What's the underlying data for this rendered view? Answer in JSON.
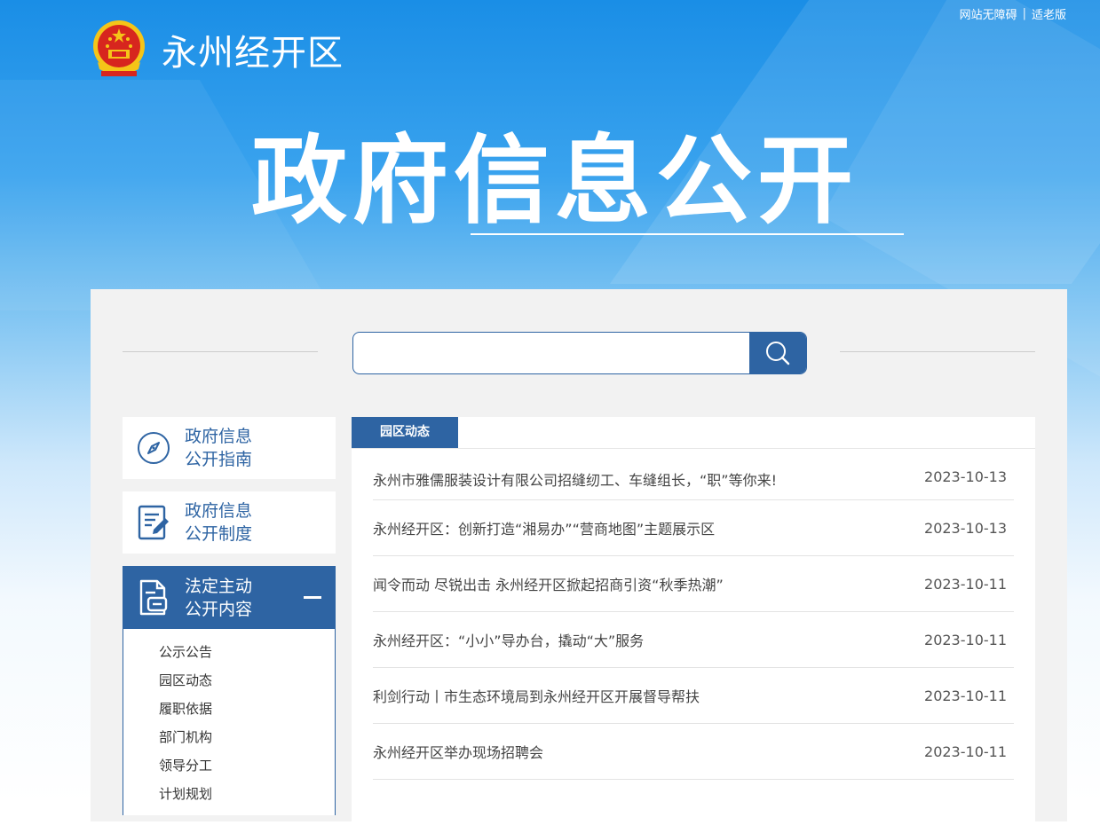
{
  "header": {
    "site_name": "永州经开区",
    "links": [
      "网站无障碍",
      "适老版"
    ],
    "separator": "|",
    "banner_title": "政府信息公开"
  },
  "search": {
    "placeholder": "",
    "button_icon": "search-icon"
  },
  "sidebar": {
    "cards": [
      {
        "line1": "政府信息",
        "line2": "公开指南",
        "icon": "compass-icon"
      },
      {
        "line1": "政府信息",
        "line2": "公开制度",
        "icon": "document-edit-icon"
      },
      {
        "line1": "法定主动",
        "line2": "公开内容",
        "icon": "document-list-icon",
        "expanded": true
      }
    ],
    "sub_items": [
      "公示公告",
      "园区动态",
      "履职依据",
      "部门机构",
      "领导分工",
      "计划规划"
    ]
  },
  "news": {
    "tab_label": "园区动态",
    "items": [
      {
        "title": "永州市雅儒服装设计有限公司招缝纫工、车缝组长，“职”等你来!",
        "date": "2023-10-13"
      },
      {
        "title": "永州经开区：创新打造“湘易办”“营商地图”主题展示区",
        "date": "2023-10-13"
      },
      {
        "title": "闻令而动 尽锐出击 永州经开区掀起招商引资“秋季热潮”",
        "date": "2023-10-11"
      },
      {
        "title": "永州经开区：“小小”导办台，撬动“大”服务",
        "date": "2023-10-11"
      },
      {
        "title": "利剑行动丨市生态环境局到永州经开区开展督导帮扶",
        "date": "2023-10-11"
      },
      {
        "title": "永州经开区举办现场招聘会",
        "date": "2023-10-11"
      }
    ]
  },
  "colors": {
    "primary": "#2e64a3",
    "hero_top": "#1a8ee6"
  }
}
